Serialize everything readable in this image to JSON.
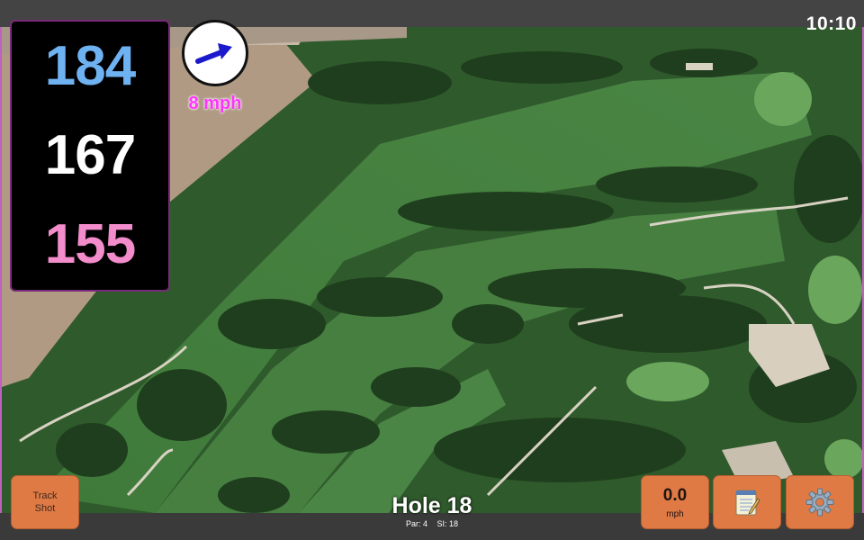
{
  "status": {
    "time": "10:10"
  },
  "distances": {
    "back": "184",
    "middle": "167",
    "front": "155"
  },
  "wind": {
    "speed": "8 mph",
    "icon": "wind-direction-arrow-icon"
  },
  "hole": {
    "title": "Hole 18",
    "par": "Par: 4",
    "stroke_index": "SI: 18"
  },
  "buttons": {
    "track_shot": {
      "line1": "Track",
      "line2": "Shot"
    },
    "speed": {
      "value": "0.0",
      "unit": "mph"
    },
    "notes_icon": "notepad-icon",
    "settings_icon": "gear-icon"
  },
  "colors": {
    "back": "#6fb2f2",
    "middle": "#ffffff",
    "front": "#f28ccb",
    "button": "#e07a45",
    "wind_text": "#ff33ff",
    "wind_arrow": "#1a1acc"
  }
}
